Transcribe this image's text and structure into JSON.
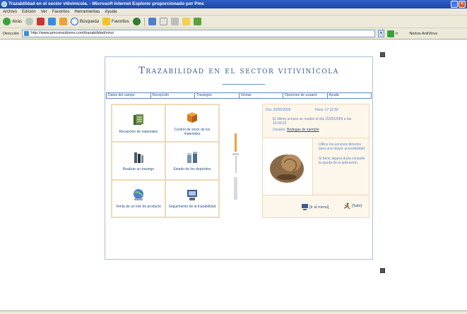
{
  "window": {
    "title": "Trazabilidad en el sector vitivinícola. - Microsoft Internet Explorer proporcionado por Pmc"
  },
  "menu": [
    "Archivo",
    "Edición",
    "Ver",
    "Favoritos",
    "Herramientas",
    "Ayuda"
  ],
  "toolbar": {
    "back": "Atrás",
    "search": "Búsqueda",
    "favorites": "Favoritos"
  },
  "address": {
    "label": "Dirección",
    "url": "http://www.pmconsultores.com/trazabilidad/vino/",
    "go": "Ir",
    "links": "Norton AntiVirus"
  },
  "site": {
    "title": "Trazabilidad en el sector vitivinícola",
    "nav": [
      "Datos del campo",
      "Recepción",
      "Trasiegos",
      "Ventas",
      "Opciones de usuario",
      "Ayuda"
    ],
    "modules": [
      {
        "label": "Recepción de materiales",
        "icon": "document-stack-icon",
        "color": "#3a5f2a"
      },
      {
        "label": "Control de stock de los materiales",
        "icon": "boxes-icon",
        "color": "#d9781f"
      },
      {
        "label": "Realizar un trasiego",
        "icon": "bottles-icon",
        "color": "#4a5a6a"
      },
      {
        "label": "Estado de los depósitos",
        "icon": "tanks-icon",
        "color": "#7f95b0"
      },
      {
        "label": "Venta de un lote de producto",
        "icon": "globe-icon",
        "color": "#4d7fd0"
      },
      {
        "label": "Seguimiento de la trazabilidad",
        "icon": "computer-icon",
        "color": "#3b5a93"
      }
    ],
    "panel": {
      "date": "Día: 20/05/2005",
      "time": "Hora: 17:32:55",
      "message": "El último acceso se realizó el día 20/05/2005 a las 10:00:22",
      "user": "Usuario:",
      "user_name": "Bodegas de ejemplo",
      "tip1": "Utilice los accesos directos para una mayor accesibilidad.",
      "tip2": "Si tiene alguna duda consulte la ayuda de la aplicación.",
      "menu_btn": "[Ir al menú]",
      "exit_btn": "[Salir]"
    }
  }
}
